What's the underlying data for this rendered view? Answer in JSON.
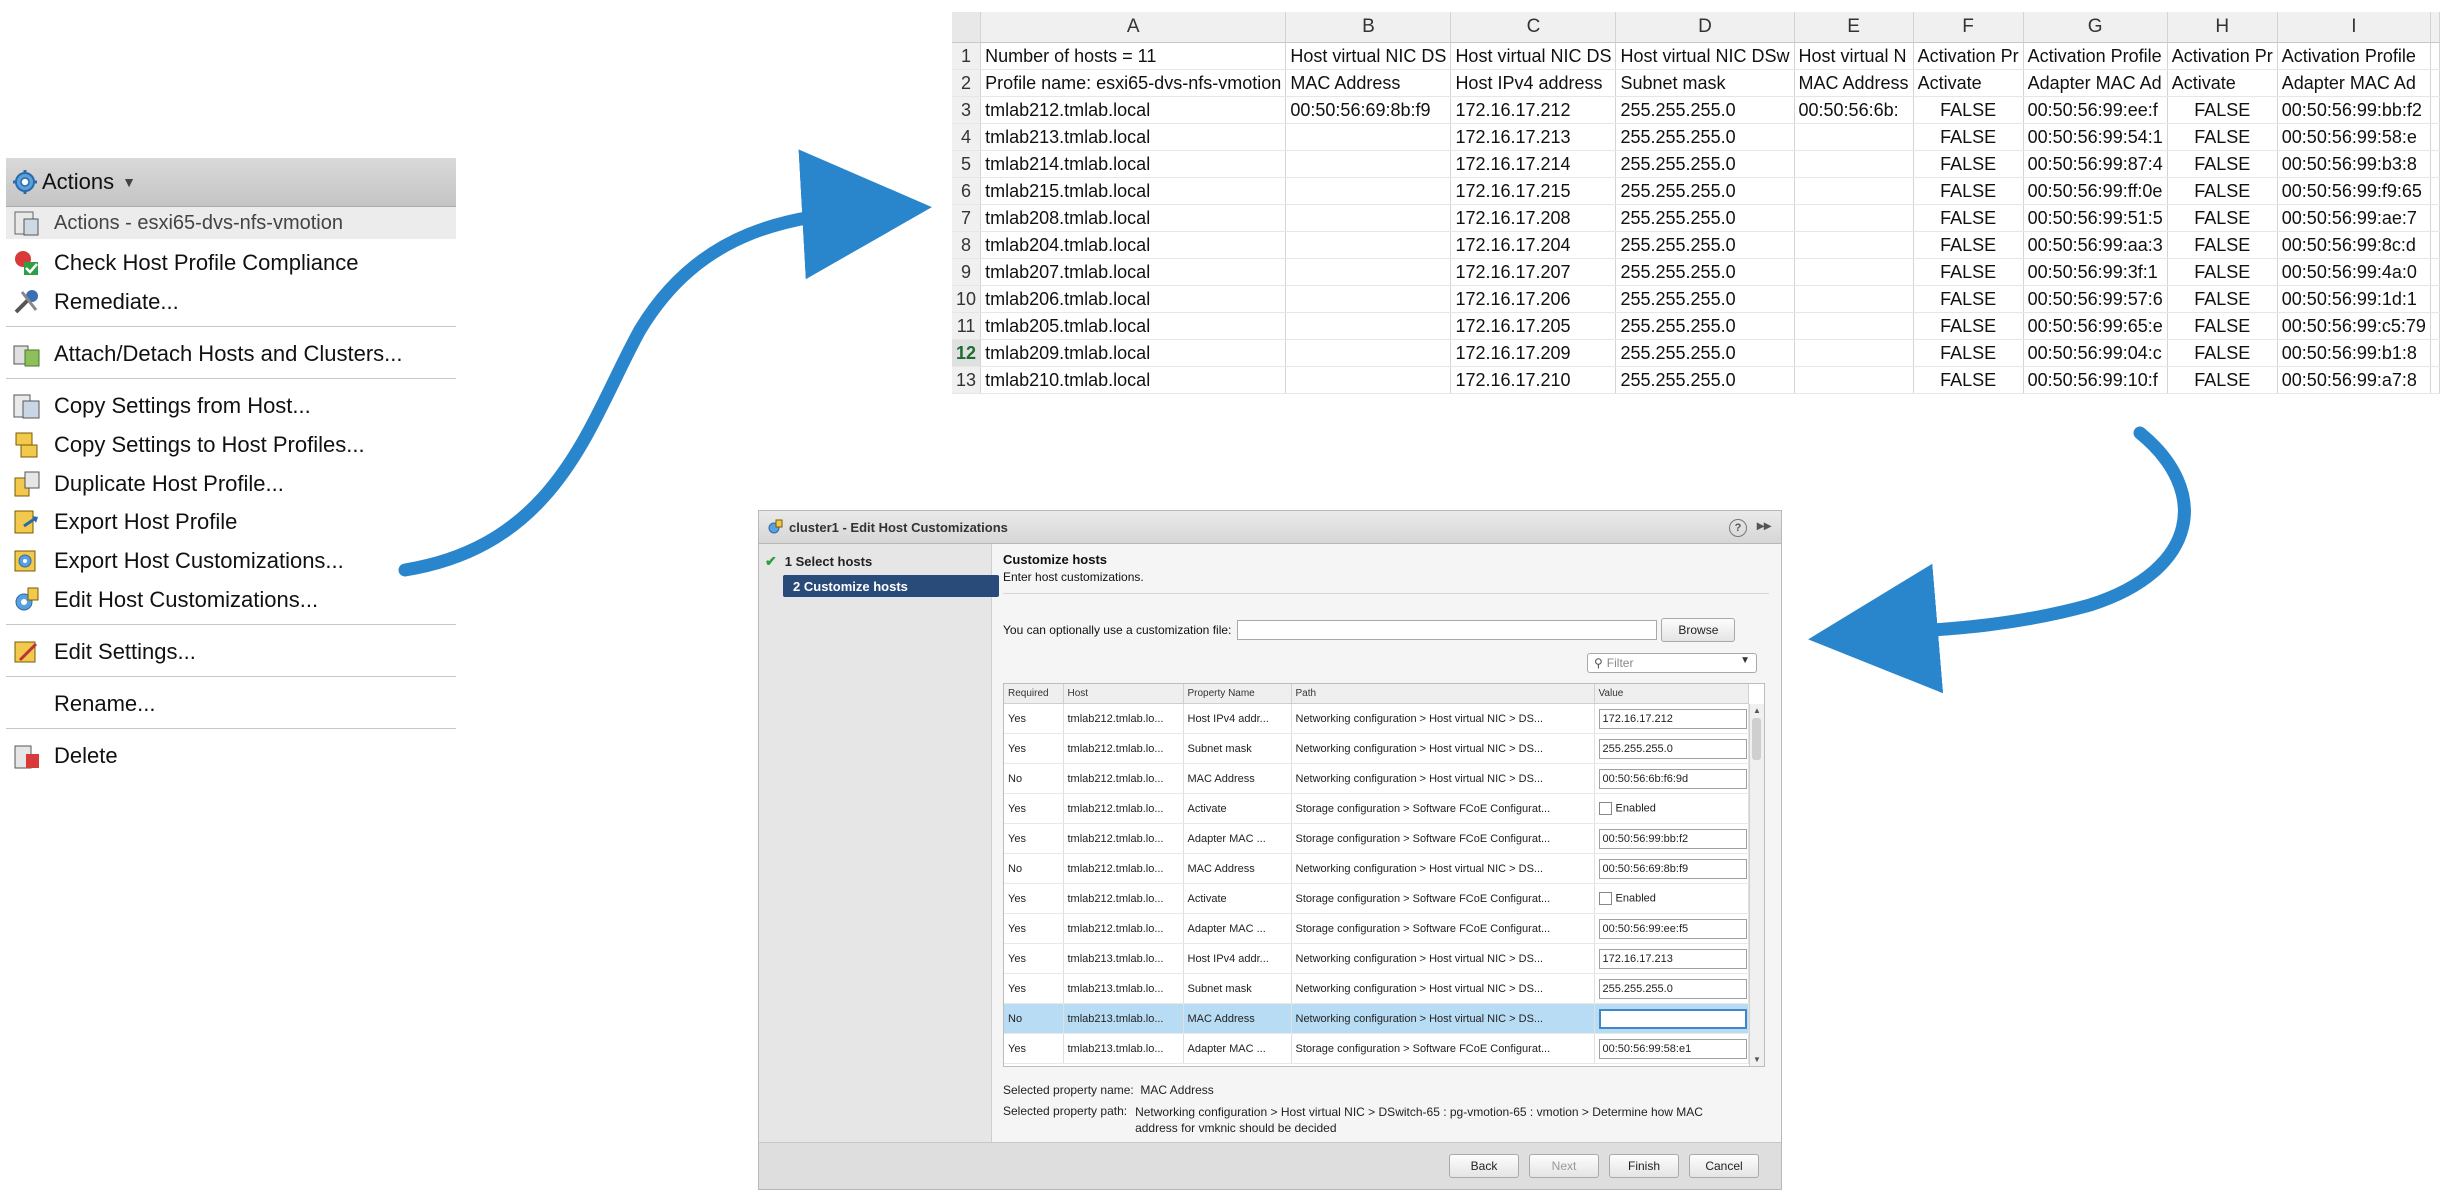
{
  "menu": {
    "title": "Actions",
    "items": [
      {
        "label": "Actions - esxi65-dvs-nfs-vmotion",
        "icon": "host-profile-icon"
      },
      {
        "label": "Check Host Profile Compliance",
        "icon": "compliance-check-icon"
      },
      {
        "label": "Remediate...",
        "icon": "remediate-tools-icon"
      },
      {
        "label": "Attach/Detach Hosts and Clusters...",
        "icon": "attach-detach-icon"
      },
      {
        "label": "Copy Settings from Host...",
        "icon": "copy-settings-icon"
      },
      {
        "label": "Copy Settings to Host Profiles...",
        "icon": "copy-to-profiles-icon"
      },
      {
        "label": "Duplicate Host Profile...",
        "icon": "duplicate-profile-icon"
      },
      {
        "label": "Export Host Profile",
        "icon": "export-profile-icon"
      },
      {
        "label": "Export Host Customizations...",
        "icon": "export-customizations-icon"
      },
      {
        "label": "Edit Host Customizations...",
        "icon": "edit-customizations-icon"
      },
      {
        "label": "Edit Settings...",
        "icon": "edit-settings-icon"
      },
      {
        "label": "Rename...",
        "icon": ""
      },
      {
        "label": "Delete",
        "icon": "delete-icon"
      }
    ]
  },
  "spreadsheet": {
    "columns": [
      "A",
      "B",
      "C",
      "D",
      "E",
      "F",
      "G",
      "H",
      "I"
    ],
    "row_numbers": [
      "1",
      "2",
      "3",
      "4",
      "5",
      "6",
      "7",
      "8",
      "9",
      "10",
      "11",
      "12",
      "13"
    ],
    "selected_row": "12",
    "rows": [
      [
        "Number of hosts = 11",
        "Host virtual NIC DS",
        "Host virtual NIC DS",
        "Host virtual NIC DSw",
        "Host virtual N",
        "Activation Pr",
        "Activation Profile",
        "Activation Pr",
        "Activation Profile"
      ],
      [
        "Profile name: esxi65-dvs-nfs-vmotion",
        "MAC Address",
        "Host IPv4 address",
        "Subnet mask",
        "MAC Address",
        "Activate",
        "Adapter MAC Ad",
        "Activate",
        "Adapter MAC Ad"
      ],
      [
        "tmlab212.tmlab.local",
        "00:50:56:69:8b:f9",
        "172.16.17.212",
        "255.255.255.0",
        "00:50:56:6b:",
        "FALSE",
        "00:50:56:99:ee:f",
        "FALSE",
        "00:50:56:99:bb:f2"
      ],
      [
        "tmlab213.tmlab.local",
        "",
        "172.16.17.213",
        "255.255.255.0",
        "",
        "FALSE",
        "00:50:56:99:54:1",
        "FALSE",
        "00:50:56:99:58:e"
      ],
      [
        "tmlab214.tmlab.local",
        "",
        "172.16.17.214",
        "255.255.255.0",
        "",
        "FALSE",
        "00:50:56:99:87:4",
        "FALSE",
        "00:50:56:99:b3:8"
      ],
      [
        "tmlab215.tmlab.local",
        "",
        "172.16.17.215",
        "255.255.255.0",
        "",
        "FALSE",
        "00:50:56:99:ff:0e",
        "FALSE",
        "00:50:56:99:f9:65"
      ],
      [
        "tmlab208.tmlab.local",
        "",
        "172.16.17.208",
        "255.255.255.0",
        "",
        "FALSE",
        "00:50:56:99:51:5",
        "FALSE",
        "00:50:56:99:ae:7"
      ],
      [
        "tmlab204.tmlab.local",
        "",
        "172.16.17.204",
        "255.255.255.0",
        "",
        "FALSE",
        "00:50:56:99:aa:3",
        "FALSE",
        "00:50:56:99:8c:d"
      ],
      [
        "tmlab207.tmlab.local",
        "",
        "172.16.17.207",
        "255.255.255.0",
        "",
        "FALSE",
        "00:50:56:99:3f:1",
        "FALSE",
        "00:50:56:99:4a:0"
      ],
      [
        "tmlab206.tmlab.local",
        "",
        "172.16.17.206",
        "255.255.255.0",
        "",
        "FALSE",
        "00:50:56:99:57:6",
        "FALSE",
        "00:50:56:99:1d:1"
      ],
      [
        "tmlab205.tmlab.local",
        "",
        "172.16.17.205",
        "255.255.255.0",
        "",
        "FALSE",
        "00:50:56:99:65:e",
        "FALSE",
        "00:50:56:99:c5:79"
      ],
      [
        "tmlab209.tmlab.local",
        "",
        "172.16.17.209",
        "255.255.255.0",
        "",
        "FALSE",
        "00:50:56:99:04:c",
        "FALSE",
        "00:50:56:99:b1:8"
      ],
      [
        "tmlab210.tmlab.local",
        "",
        "172.16.17.210",
        "255.255.255.0",
        "",
        "FALSE",
        "00:50:56:99:10:f",
        "FALSE",
        "00:50:56:99:a7:8"
      ]
    ]
  },
  "dialog": {
    "title": "cluster1 - Edit Host Customizations",
    "help": "?",
    "steps": [
      {
        "num": "1",
        "label": "Select hosts"
      },
      {
        "num": "2",
        "label": "Customize hosts"
      }
    ],
    "heading": "Customize hosts",
    "subheading": "Enter host customizations.",
    "file_label": "You can optionally use a customization file:",
    "file_value": "",
    "browse_label": "Browse",
    "filter_placeholder": "Filter",
    "grid_headers": [
      "Required",
      "Host",
      "Property Name",
      "Path",
      "Value"
    ],
    "grid_rows": [
      {
        "required": "Yes",
        "host": "tmlab212.tmlab.lo...",
        "property": "Host IPv4 addr...",
        "path": "Networking configuration > Host virtual NIC > DS...",
        "value": "172.16.17.212",
        "kind": "text"
      },
      {
        "required": "Yes",
        "host": "tmlab212.tmlab.lo...",
        "property": "Subnet mask",
        "path": "Networking configuration > Host virtual NIC > DS...",
        "value": "255.255.255.0",
        "kind": "text"
      },
      {
        "required": "No",
        "host": "tmlab212.tmlab.lo...",
        "property": "MAC Address",
        "path": "Networking configuration > Host virtual NIC > DS...",
        "value": "00:50:56:6b:f6:9d",
        "kind": "text"
      },
      {
        "required": "Yes",
        "host": "tmlab212.tmlab.lo...",
        "property": "Activate",
        "path": "Storage configuration > Software FCoE Configurat...",
        "value": "Enabled",
        "kind": "checkbox"
      },
      {
        "required": "Yes",
        "host": "tmlab212.tmlab.lo...",
        "property": "Adapter MAC ...",
        "path": "Storage configuration > Software FCoE Configurat...",
        "value": "00:50:56:99:bb:f2",
        "kind": "text"
      },
      {
        "required": "No",
        "host": "tmlab212.tmlab.lo...",
        "property": "MAC Address",
        "path": "Networking configuration > Host virtual NIC > DS...",
        "value": "00:50:56:69:8b:f9",
        "kind": "text"
      },
      {
        "required": "Yes",
        "host": "tmlab212.tmlab.lo...",
        "property": "Activate",
        "path": "Storage configuration > Software FCoE Configurat...",
        "value": "Enabled",
        "kind": "checkbox"
      },
      {
        "required": "Yes",
        "host": "tmlab212.tmlab.lo...",
        "property": "Adapter MAC ...",
        "path": "Storage configuration > Software FCoE Configurat...",
        "value": "00:50:56:99:ee:f5",
        "kind": "text"
      },
      {
        "required": "Yes",
        "host": "tmlab213.tmlab.lo...",
        "property": "Host IPv4 addr...",
        "path": "Networking configuration > Host virtual NIC > DS...",
        "value": "172.16.17.213",
        "kind": "text"
      },
      {
        "required": "Yes",
        "host": "tmlab213.tmlab.lo...",
        "property": "Subnet mask",
        "path": "Networking configuration > Host virtual NIC > DS...",
        "value": "255.255.255.0",
        "kind": "text"
      },
      {
        "required": "No",
        "host": "tmlab213.tmlab.lo...",
        "property": "MAC Address",
        "path": "Networking configuration > Host virtual NIC > DS...",
        "value": "",
        "kind": "text",
        "selected": true
      },
      {
        "required": "Yes",
        "host": "tmlab213.tmlab.lo...",
        "property": "Adapter MAC ...",
        "path": "Storage configuration > Software FCoE Configurat...",
        "value": "00:50:56:99:58:e1",
        "kind": "text"
      }
    ],
    "selected_name_label": "Selected property name:",
    "selected_name_value": "MAC Address",
    "selected_path_label": "Selected property path:",
    "selected_path_value": "Networking configuration > Host virtual NIC > DSwitch-65 : pg-vmotion-65 : vmotion > Determine how MAC address for vmknic should be decided",
    "buttons": {
      "back": "Back",
      "next": "Next",
      "finish": "Finish",
      "cancel": "Cancel"
    }
  },
  "colors": {
    "arrow": "#2a86cc",
    "step_active": "#284b79",
    "selected_row": "#b9dcf5"
  }
}
